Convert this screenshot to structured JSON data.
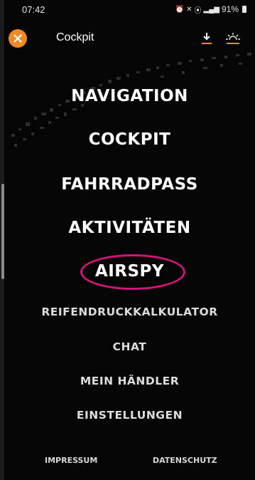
{
  "status_bar": {
    "time": "07:42",
    "battery": "91%",
    "icons": [
      "alarm-icon",
      "mute-icon",
      "location-icon",
      "lte-signal-icon",
      "battery-icon"
    ]
  },
  "header": {
    "title": "Cockpit",
    "close_icon": "close-icon",
    "download_icon": "download-icon",
    "brightness_icon": "brightness-icon",
    "accent_color": "#f08a24"
  },
  "menu": {
    "items": [
      {
        "label": "NAVIGATION"
      },
      {
        "label": "COCKPIT"
      },
      {
        "label": "FAHRRADPASS"
      },
      {
        "label": "AKTIVITÄTEN"
      },
      {
        "label": "AIRSPY"
      },
      {
        "label": "REIFENDRUCKKALKULATOR"
      },
      {
        "label": "CHAT"
      },
      {
        "label": "MEIN HÄNDLER"
      },
      {
        "label": "EINSTELLUNGEN"
      }
    ],
    "highlight_color": "#d4147a"
  },
  "footer": {
    "impressum": "IMPRESSUM",
    "datenschutz": "DATENSCHUTZ"
  }
}
